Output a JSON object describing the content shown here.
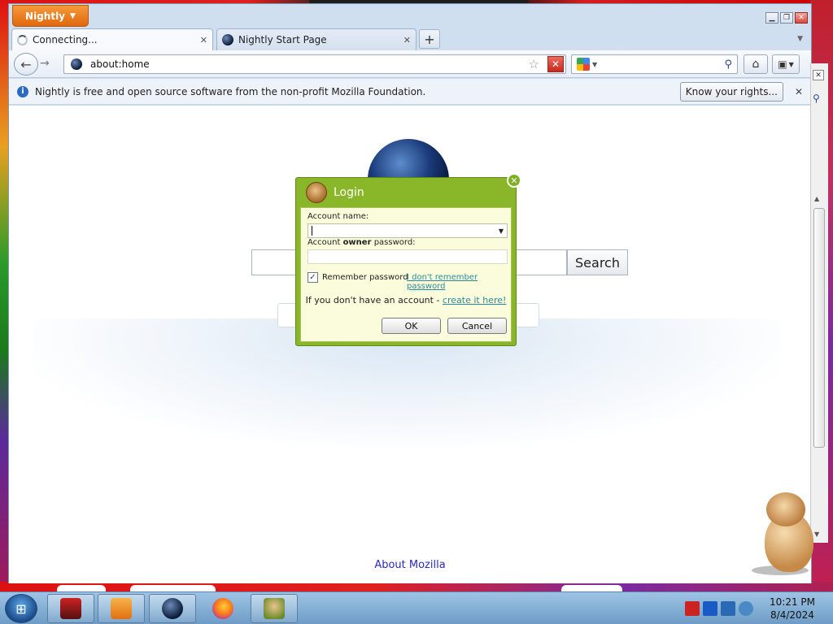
{
  "window": {
    "app_button": "Nightly"
  },
  "tabs": [
    {
      "label": "Connecting...",
      "state": "loading"
    },
    {
      "label": "Nightly Start Page",
      "state": "loaded"
    }
  ],
  "navbar": {
    "url": "about:home"
  },
  "infobar": {
    "message": "Nightly is free and open source software from the non-profit Mozilla Foundation.",
    "button_label": "Know your rights..."
  },
  "home": {
    "search_button": "Search",
    "about_link": "About Mozilla"
  },
  "login_dialog": {
    "title": "Login",
    "account_name_label": "Account name:",
    "password_label_prefix": "Account ",
    "password_label_bold": "owner",
    "password_label_suffix": " password:",
    "remember_label": "Remember password",
    "remember_checked": true,
    "forgot_link": "I don't remember password",
    "no_account_text": "If you don't have an account - ",
    "create_link": "create it here!",
    "ok_label": "OK",
    "cancel_label": "Cancel"
  },
  "taskbar": {
    "time": "10:21 PM",
    "date": "8/4/2024"
  },
  "colors": {
    "app_button": "#e0680e",
    "dialog_frame": "#8ab72a",
    "dialog_body": "#fbfcdc",
    "link": "#2a8a9a"
  }
}
